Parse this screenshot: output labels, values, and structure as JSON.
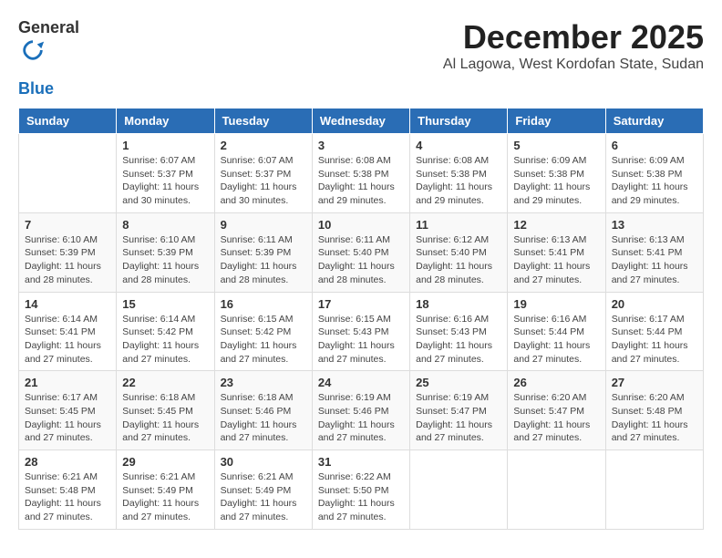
{
  "logo": {
    "general": "General",
    "blue": "Blue"
  },
  "title": {
    "month": "December 2025",
    "location": "Al Lagowa, West Kordofan State, Sudan"
  },
  "headers": [
    "Sunday",
    "Monday",
    "Tuesday",
    "Wednesday",
    "Thursday",
    "Friday",
    "Saturday"
  ],
  "weeks": [
    [
      {
        "day": "",
        "sunrise": "",
        "sunset": "",
        "daylight": ""
      },
      {
        "day": "1",
        "sunrise": "Sunrise: 6:07 AM",
        "sunset": "Sunset: 5:37 PM",
        "daylight": "Daylight: 11 hours and 30 minutes."
      },
      {
        "day": "2",
        "sunrise": "Sunrise: 6:07 AM",
        "sunset": "Sunset: 5:37 PM",
        "daylight": "Daylight: 11 hours and 30 minutes."
      },
      {
        "day": "3",
        "sunrise": "Sunrise: 6:08 AM",
        "sunset": "Sunset: 5:38 PM",
        "daylight": "Daylight: 11 hours and 29 minutes."
      },
      {
        "day": "4",
        "sunrise": "Sunrise: 6:08 AM",
        "sunset": "Sunset: 5:38 PM",
        "daylight": "Daylight: 11 hours and 29 minutes."
      },
      {
        "day": "5",
        "sunrise": "Sunrise: 6:09 AM",
        "sunset": "Sunset: 5:38 PM",
        "daylight": "Daylight: 11 hours and 29 minutes."
      },
      {
        "day": "6",
        "sunrise": "Sunrise: 6:09 AM",
        "sunset": "Sunset: 5:38 PM",
        "daylight": "Daylight: 11 hours and 29 minutes."
      }
    ],
    [
      {
        "day": "7",
        "sunrise": "Sunrise: 6:10 AM",
        "sunset": "Sunset: 5:39 PM",
        "daylight": "Daylight: 11 hours and 28 minutes."
      },
      {
        "day": "8",
        "sunrise": "Sunrise: 6:10 AM",
        "sunset": "Sunset: 5:39 PM",
        "daylight": "Daylight: 11 hours and 28 minutes."
      },
      {
        "day": "9",
        "sunrise": "Sunrise: 6:11 AM",
        "sunset": "Sunset: 5:39 PM",
        "daylight": "Daylight: 11 hours and 28 minutes."
      },
      {
        "day": "10",
        "sunrise": "Sunrise: 6:11 AM",
        "sunset": "Sunset: 5:40 PM",
        "daylight": "Daylight: 11 hours and 28 minutes."
      },
      {
        "day": "11",
        "sunrise": "Sunrise: 6:12 AM",
        "sunset": "Sunset: 5:40 PM",
        "daylight": "Daylight: 11 hours and 28 minutes."
      },
      {
        "day": "12",
        "sunrise": "Sunrise: 6:13 AM",
        "sunset": "Sunset: 5:41 PM",
        "daylight": "Daylight: 11 hours and 27 minutes."
      },
      {
        "day": "13",
        "sunrise": "Sunrise: 6:13 AM",
        "sunset": "Sunset: 5:41 PM",
        "daylight": "Daylight: 11 hours and 27 minutes."
      }
    ],
    [
      {
        "day": "14",
        "sunrise": "Sunrise: 6:14 AM",
        "sunset": "Sunset: 5:41 PM",
        "daylight": "Daylight: 11 hours and 27 minutes."
      },
      {
        "day": "15",
        "sunrise": "Sunrise: 6:14 AM",
        "sunset": "Sunset: 5:42 PM",
        "daylight": "Daylight: 11 hours and 27 minutes."
      },
      {
        "day": "16",
        "sunrise": "Sunrise: 6:15 AM",
        "sunset": "Sunset: 5:42 PM",
        "daylight": "Daylight: 11 hours and 27 minutes."
      },
      {
        "day": "17",
        "sunrise": "Sunrise: 6:15 AM",
        "sunset": "Sunset: 5:43 PM",
        "daylight": "Daylight: 11 hours and 27 minutes."
      },
      {
        "day": "18",
        "sunrise": "Sunrise: 6:16 AM",
        "sunset": "Sunset: 5:43 PM",
        "daylight": "Daylight: 11 hours and 27 minutes."
      },
      {
        "day": "19",
        "sunrise": "Sunrise: 6:16 AM",
        "sunset": "Sunset: 5:44 PM",
        "daylight": "Daylight: 11 hours and 27 minutes."
      },
      {
        "day": "20",
        "sunrise": "Sunrise: 6:17 AM",
        "sunset": "Sunset: 5:44 PM",
        "daylight": "Daylight: 11 hours and 27 minutes."
      }
    ],
    [
      {
        "day": "21",
        "sunrise": "Sunrise: 6:17 AM",
        "sunset": "Sunset: 5:45 PM",
        "daylight": "Daylight: 11 hours and 27 minutes."
      },
      {
        "day": "22",
        "sunrise": "Sunrise: 6:18 AM",
        "sunset": "Sunset: 5:45 PM",
        "daylight": "Daylight: 11 hours and 27 minutes."
      },
      {
        "day": "23",
        "sunrise": "Sunrise: 6:18 AM",
        "sunset": "Sunset: 5:46 PM",
        "daylight": "Daylight: 11 hours and 27 minutes."
      },
      {
        "day": "24",
        "sunrise": "Sunrise: 6:19 AM",
        "sunset": "Sunset: 5:46 PM",
        "daylight": "Daylight: 11 hours and 27 minutes."
      },
      {
        "day": "25",
        "sunrise": "Sunrise: 6:19 AM",
        "sunset": "Sunset: 5:47 PM",
        "daylight": "Daylight: 11 hours and 27 minutes."
      },
      {
        "day": "26",
        "sunrise": "Sunrise: 6:20 AM",
        "sunset": "Sunset: 5:47 PM",
        "daylight": "Daylight: 11 hours and 27 minutes."
      },
      {
        "day": "27",
        "sunrise": "Sunrise: 6:20 AM",
        "sunset": "Sunset: 5:48 PM",
        "daylight": "Daylight: 11 hours and 27 minutes."
      }
    ],
    [
      {
        "day": "28",
        "sunrise": "Sunrise: 6:21 AM",
        "sunset": "Sunset: 5:48 PM",
        "daylight": "Daylight: 11 hours and 27 minutes."
      },
      {
        "day": "29",
        "sunrise": "Sunrise: 6:21 AM",
        "sunset": "Sunset: 5:49 PM",
        "daylight": "Daylight: 11 hours and 27 minutes."
      },
      {
        "day": "30",
        "sunrise": "Sunrise: 6:21 AM",
        "sunset": "Sunset: 5:49 PM",
        "daylight": "Daylight: 11 hours and 27 minutes."
      },
      {
        "day": "31",
        "sunrise": "Sunrise: 6:22 AM",
        "sunset": "Sunset: 5:50 PM",
        "daylight": "Daylight: 11 hours and 27 minutes."
      },
      {
        "day": "",
        "sunrise": "",
        "sunset": "",
        "daylight": ""
      },
      {
        "day": "",
        "sunrise": "",
        "sunset": "",
        "daylight": ""
      },
      {
        "day": "",
        "sunrise": "",
        "sunset": "",
        "daylight": ""
      }
    ]
  ]
}
